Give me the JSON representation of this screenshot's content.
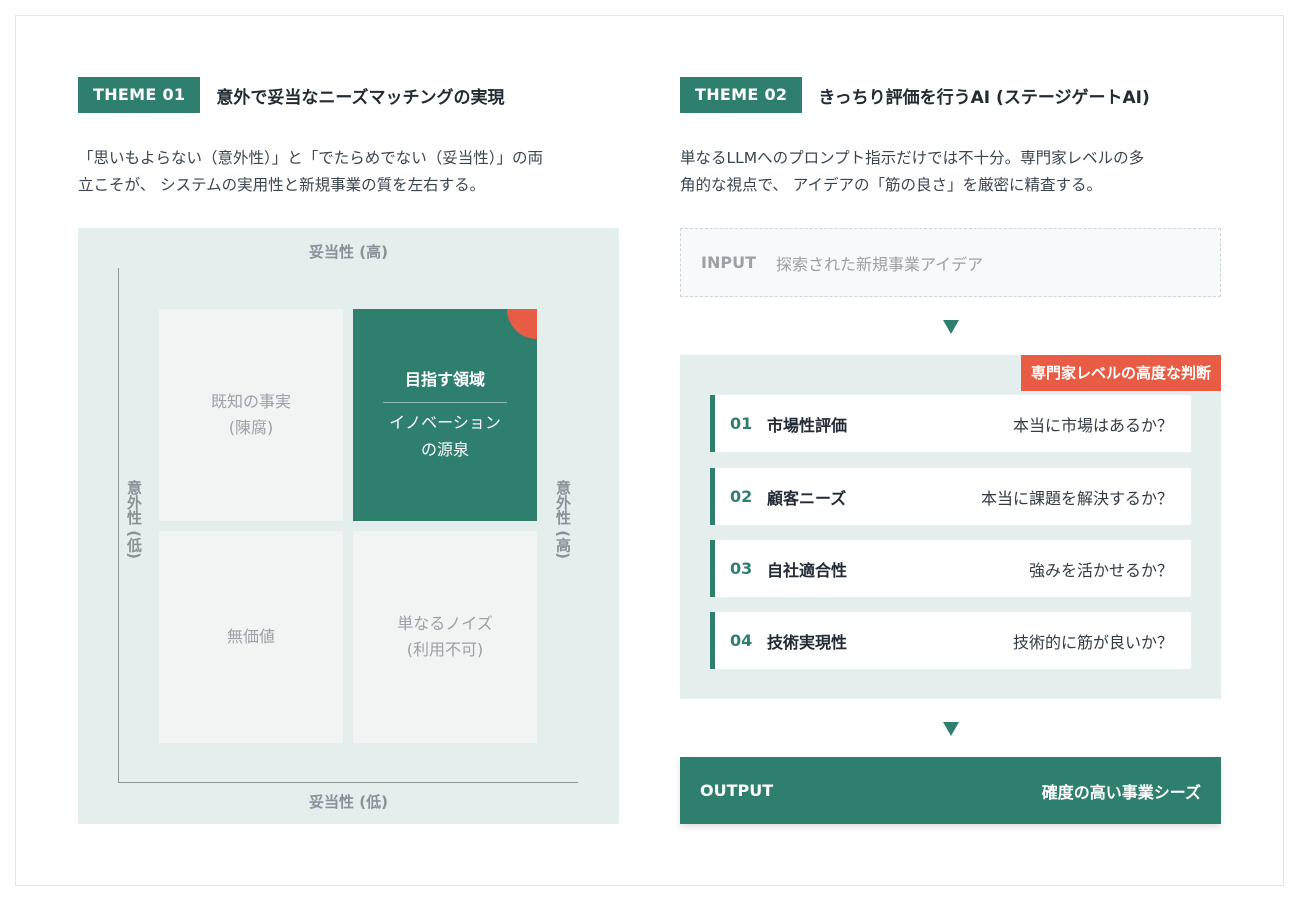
{
  "theme1": {
    "tag": "THEME 01",
    "title": "意外で妥当なニーズマッチングの実現",
    "lead_line1": "「思いもよらない（意外性）」と「でたらめでない（妥当性）」の両",
    "lead_line2": "立こそが、 システムの実用性と新規事業の質を左右する。"
  },
  "matrix": {
    "axis_top": "妥当性 (高)",
    "axis_bottom": "妥当性 (低)",
    "axis_left": "意外性 (低)",
    "axis_right": "意外性 (高)",
    "cells": {
      "top_left_line1": "既知の事実",
      "top_left_line2": "(陳腐)",
      "top_right_title": "目指す領域",
      "top_right_line1": "イノベーション",
      "top_right_line2": "の源泉",
      "bottom_left": "無価値",
      "bottom_right_line1": "単なるノイズ",
      "bottom_right_line2": "(利用不可)"
    },
    "colors": {
      "accent": "#2f7f6f",
      "highlight": "#e85c45",
      "panel": "#e4eeed"
    }
  },
  "theme2": {
    "tag": "THEME 02",
    "title": "きっちり評価を行うAI (ステージゲートAI)",
    "lead_line1": "単なるLLMへのプロンプト指示だけでは不十分。専門家レベルの多",
    "lead_line2": "角的な視点で、 アイデアの「筋の良さ」を厳密に精査する。"
  },
  "flow": {
    "input_label": "INPUT",
    "input_text": "探索された新規事業アイデア",
    "badge": "専門家レベルの高度な判断",
    "checks": [
      {
        "num": "01",
        "name": "市場性評価",
        "question": "本当に市場はあるか？"
      },
      {
        "num": "02",
        "name": "顧客ニーズ",
        "question": "本当に課題を解決するか？"
      },
      {
        "num": "03",
        "name": "自社適合性",
        "question": "強みを活かせるか？"
      },
      {
        "num": "04",
        "name": "技術実現性",
        "question": "技術的に筋が良いか？"
      }
    ],
    "output_label": "OUTPUT",
    "output_text": "確度の高い事業シーズ"
  }
}
